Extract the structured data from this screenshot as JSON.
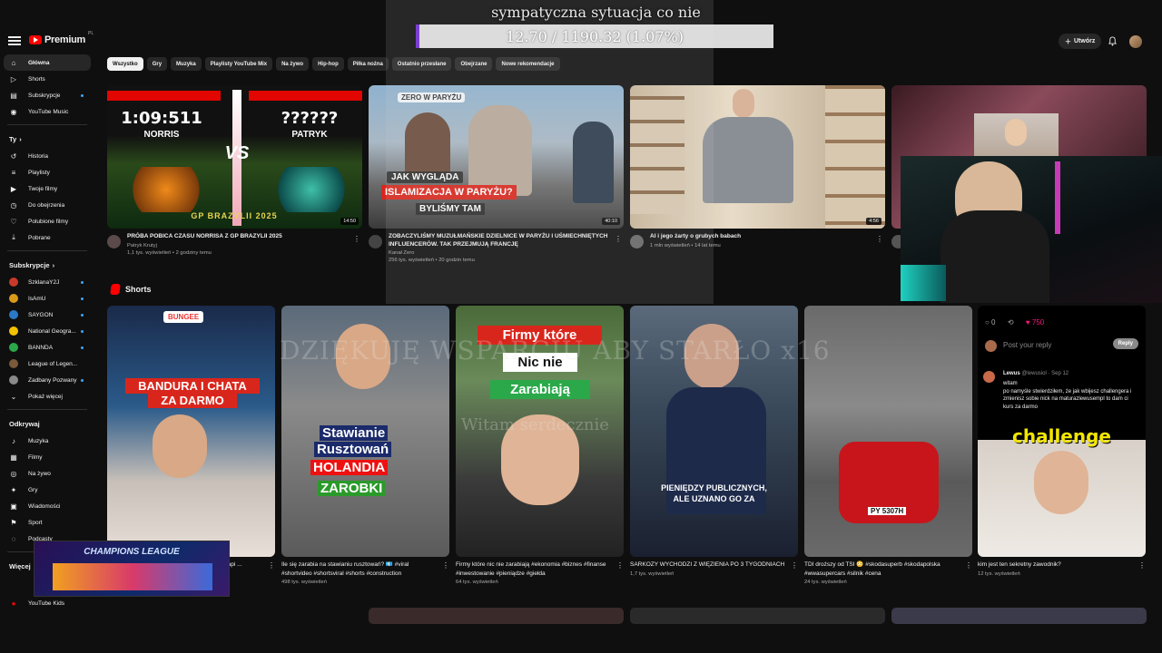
{
  "header": {
    "logo_text": "Premium",
    "logo_sup": "PL",
    "create_label": "Utwórz"
  },
  "sidebar": {
    "main": [
      {
        "label": "Główna",
        "icon": "home-icon"
      },
      {
        "label": "Shorts",
        "icon": "shorts-icon"
      },
      {
        "label": "Subskrypcje",
        "icon": "subscriptions-icon"
      },
      {
        "label": "YouTube Music",
        "icon": "music-icon"
      }
    ],
    "you_header": "Ty",
    "you": [
      {
        "label": "Historia",
        "icon": "history-icon"
      },
      {
        "label": "Playlisty",
        "icon": "playlists-icon"
      },
      {
        "label": "Twoje filmy",
        "icon": "your-videos-icon"
      },
      {
        "label": "Do obejrzenia",
        "icon": "watch-later-icon"
      },
      {
        "label": "Polubione filmy",
        "icon": "liked-icon"
      },
      {
        "label": "Pobrane",
        "icon": "download-icon"
      }
    ],
    "subs_header": "Subskrypcje",
    "subs": [
      {
        "label": "SzklanaY2J",
        "color": "#c73a2a"
      },
      {
        "label": "IsAmU",
        "color": "#d99a1a"
      },
      {
        "label": "SAYGON",
        "color": "#2a7ac7"
      },
      {
        "label": "National Geogra...",
        "color": "#f2c200"
      },
      {
        "label": "BANNDA",
        "color": "#2aa84a"
      },
      {
        "label": "League of Legen...",
        "color": "#7a5a3a"
      },
      {
        "label": "Zadbany Pozwany",
        "color": "#8a8a8a"
      }
    ],
    "show_more": "Pokaż więcej",
    "explore_header": "Odkrywaj",
    "explore": [
      {
        "label": "Muzyka",
        "icon": "music-note-icon"
      },
      {
        "label": "Filmy",
        "icon": "film-icon"
      },
      {
        "label": "Na żywo",
        "icon": "live-icon"
      },
      {
        "label": "Gry",
        "icon": "gaming-icon"
      },
      {
        "label": "Wiadomości",
        "icon": "news-icon"
      },
      {
        "label": "Sport",
        "icon": "sport-icon"
      },
      {
        "label": "Podcasty",
        "icon": "podcast-icon"
      }
    ],
    "more_header": "Więcej",
    "more": [
      {
        "label": "YouTube Kids"
      }
    ]
  },
  "chips": [
    "Wszystko",
    "Gry",
    "Muzyka",
    "Playlisty YouTube Mix",
    "Na żywo",
    "Hip-hop",
    "Piłka nożna",
    "Ostatnio przesłane",
    "Obejrzane",
    "Nowe rekomendacje"
  ],
  "videos": [
    {
      "title": "PRÓBA POBICA CZASU NORRISA Z GP BRAZYLII 2025",
      "channel": "Patryk Krutyj",
      "stats": "1,1 tys. wyświetleń • 2 godziny temu",
      "duration": "14:50",
      "thumb_left": "1:09:511",
      "thumb_right": "??????",
      "name_left": "NORRIS",
      "name_right": "PATRYK",
      "vs": "VS",
      "banner": "GP BRAZYLII 2025"
    },
    {
      "title": "ZOBACZYLIŚMY MUZUŁMAŃSKIE DZIELNICE W PARYŻU I UŚMIECHNIĘTYCH INFLUENCERÓW. TAK PRZEJMUJĄ FRANCJĘ",
      "channel": "Kanał Zero",
      "stats": "256 tys. wyświetleń • 20 godzin temu",
      "duration": "40:10",
      "t1": "ZERO W PARYŻU",
      "t2": "JAK WYGLĄDA",
      "t3": "ISLAMIZACJA W PARYŻU?",
      "t4": "BYLIŚMY TAM"
    },
    {
      "title": "Al i jego żarty o grubych babach",
      "channel": "Piotr",
      "stats": "1 mln wyświetleń • 14 lat temu",
      "duration": "4:56"
    },
    {
      "title": "",
      "channel": "",
      "stats": "",
      "duration": ""
    }
  ],
  "shorts_title": "Shorts",
  "shorts": [
    {
      "title": "Bandura i chata za darmo! #bandura #strammapi ...",
      "views": "",
      "t1": "BUNGEE",
      "t2": "BANDURA I CHATA",
      "t3": "ZA DARMO"
    },
    {
      "title": "Ile się zarabia na stawianiu rusztowań? 💶 #viral #shortvideo #shortsviral #shorts #construction",
      "views": "498 tys. wyświetleń",
      "t1": "Stawianie",
      "t2": "Rusztowań",
      "t3": "HOLANDIA",
      "t4": "ZAROBKI"
    },
    {
      "title": "Firmy które nic nie zarabiają #ekonomia #biznes #finanse #inwestowanie #pieniądze #giełda",
      "views": "64 tys. wyświetleń",
      "t1": "Firmy które",
      "t2": "Nic nie",
      "t3": "Zarabiają"
    },
    {
      "title": "SARKOZY WYCHODZI Z WIĘZIENIA PO 3 TYGODNIACH",
      "views": "1,7 tys. wyświetleń",
      "t1": "PIENIĘDZY PUBLICZNYCH,",
      "t2": "ALE UZNANO GO ZA"
    },
    {
      "title": "TDI droższy od TSI 😳 #skodasuperb #skodapolska #wwasupercars #silnik #cena",
      "views": "24 tys. wyświetleń",
      "plate": "PY 5307H"
    },
    {
      "title": "kim jest ten sekretny zawodnik?",
      "views": "12 tys. wyświetleń",
      "reply_placeholder": "Post your reply",
      "reply_btn": "Reply",
      "tweet_user": "Lewus",
      "tweet_handle": "@lewusiol · Sep 12",
      "tweet_text": "witam\npo namyśle stwierdziłem, że jak wbijesz challengera i zmienisz sobie nick na maturazlewusempl to dam ci kurs za darmo",
      "challenge": "challenge",
      "likes": "750"
    }
  ],
  "overlays": {
    "donation_title": "sympatyczna sytuacja co nie",
    "progress_text": "12.70 / 1190.32 (1.07%)",
    "progress_fraction": 0.0107,
    "ghost_text": "DZIĘKUJĘ WSPARCIU ABY STARŁO x16",
    "ghost_sub": "Witam serdecznie",
    "cl_text": "CHAMPIONS LEAGUE"
  }
}
